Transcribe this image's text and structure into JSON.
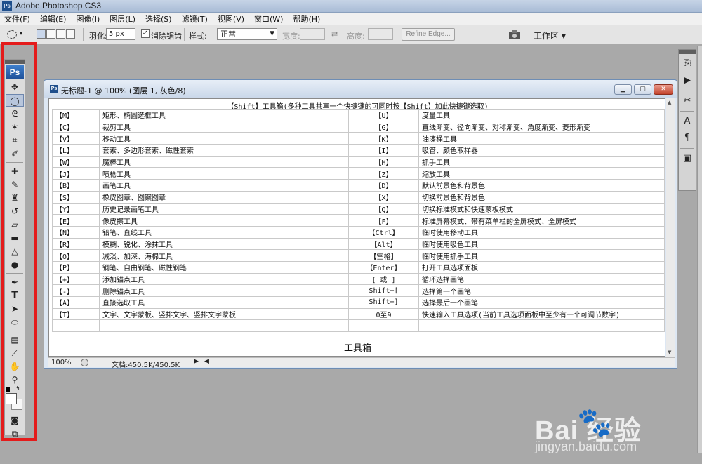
{
  "app": {
    "title": "Adobe Photoshop CS3",
    "logo": "Ps"
  },
  "menu": [
    "文件(F)",
    "编辑(E)",
    "图像(I)",
    "图层(L)",
    "选择(S)",
    "滤镜(T)",
    "视图(V)",
    "窗口(W)",
    "帮助(H)"
  ],
  "options": {
    "feather_label": "羽化:",
    "feather_value": "5 px",
    "antialias_label": "消除锯齿",
    "antialias_checked": "✓",
    "style_label": "样式:",
    "style_value": "正常",
    "width_label": "宽度:",
    "height_label": "高度:",
    "refine_edge": "Refine Edge...",
    "workspace": "工作区 ▾"
  },
  "document": {
    "title": "无标题-1 @ 100% (图层 1, 灰色/8)",
    "zoom": "100%",
    "doc_info": "文档:450.5K/450.5K",
    "caption": "【Shift】工具箱(多种工具共享一个快捷键的可同时按【Shift】加此快捷键选取)",
    "footer_title": "工具箱",
    "rows": [
      {
        "k1": "【M】",
        "d1": "矩形、椭圆选框工具",
        "k2": "【U】",
        "d2": "度量工具"
      },
      {
        "k1": "【C】",
        "d1": "裁剪工具",
        "k2": "【G】",
        "d2": "直线渐变、径向渐变、对称渐变、角度渐变、菱形渐变"
      },
      {
        "k1": "【V】",
        "d1": "移动工具",
        "k2": "【K】",
        "d2": "油漆桶工具"
      },
      {
        "k1": "【L】",
        "d1": "套索、多边形套索、磁性套索",
        "k2": "【I】",
        "d2": "吸管、颜色取样器"
      },
      {
        "k1": "【W】",
        "d1": "魔棒工具",
        "k2": "【H】",
        "d2": "抓手工具"
      },
      {
        "k1": "【J】",
        "d1": "喷枪工具",
        "k2": "【Z】",
        "d2": "缩放工具"
      },
      {
        "k1": "【B】",
        "d1": "画笔工具",
        "k2": "【D】",
        "d2": "默认前景色和背景色"
      },
      {
        "k1": "【S】",
        "d1": "橡皮图章、图案图章",
        "k2": "【X】",
        "d2": "切换前景色和背景色"
      },
      {
        "k1": "【Y】",
        "d1": "历史记录画笔工具",
        "k2": "【Q】",
        "d2": "切换标准模式和快速蒙板模式"
      },
      {
        "k1": "【E】",
        "d1": "像皮擦工具",
        "k2": "【F】",
        "d2": "标准屏幕模式、带有菜单栏的全屏模式、全屏模式"
      },
      {
        "k1": "【N】",
        "d1": "铅笔、直线工具",
        "k2": "【Ctrl】",
        "d2": "临时使用移动工具"
      },
      {
        "k1": "【R】",
        "d1": "模糊、锐化、涂抹工具",
        "k2": "【Alt】",
        "d2": "临时使用吸色工具"
      },
      {
        "k1": "【O】",
        "d1": "减淡、加深、海棉工具",
        "k2": "【空格】",
        "d2": "临时使用抓手工具"
      },
      {
        "k1": "【P】",
        "d1": "钢笔、自由钢笔、磁性钢笔",
        "k2": "【Enter】",
        "d2": "打开工具选项面板"
      },
      {
        "k1": "【+】",
        "d1": "添加锚点工具",
        "k2": "[ 或 ]",
        "d2": "循环选择画笔"
      },
      {
        "k1": "【-】",
        "d1": "删除锚点工具",
        "k2": "Shift+[",
        "d2": "选择第一个画笔"
      },
      {
        "k1": "【A】",
        "d1": "直接选取工具",
        "k2": "Shift+]",
        "d2": "选择最后一个画笔"
      },
      {
        "k1": "【T】",
        "d1": "文字、文字蒙板、竖排文字、竖排文字蒙板",
        "k2": "0至9",
        "d2": "快速输入工具选项(当前工具选项面板中至少有一个可调节数字)"
      },
      {
        "k1": "",
        "d1": "",
        "k2": "",
        "d2": ""
      }
    ]
  },
  "watermark": {
    "brand": "Bai  经验",
    "url": "jingyan.baidu.com"
  },
  "colors": {
    "highlight_frame": "#e41b1b",
    "ps_blue": "#1f4f8c"
  }
}
